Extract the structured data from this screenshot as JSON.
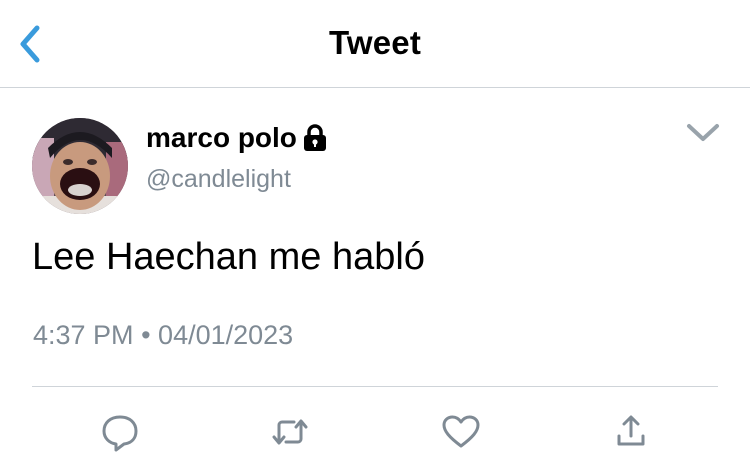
{
  "header": {
    "title": "Tweet",
    "back_icon": "chevron-left-icon",
    "accent_color": "#3a9bdc"
  },
  "tweet": {
    "author": {
      "display_name": "marco polo",
      "handle": "@candlelight",
      "protected_icon": "lock-icon"
    },
    "text": "Lee Haechan me habló",
    "time": "4:37 PM",
    "separator": "•",
    "date": "04/01/2023",
    "menu_icon": "chevron-down-icon"
  },
  "actions": [
    {
      "name": "reply",
      "icon": "comment-icon"
    },
    {
      "name": "retweet",
      "icon": "retweet-icon"
    },
    {
      "name": "like",
      "icon": "heart-icon"
    },
    {
      "name": "share",
      "icon": "share-icon"
    }
  ],
  "colors": {
    "action_icon": "#7f8a94",
    "secondary_text": "#7f8a94",
    "divider": "#cfd4d9"
  }
}
